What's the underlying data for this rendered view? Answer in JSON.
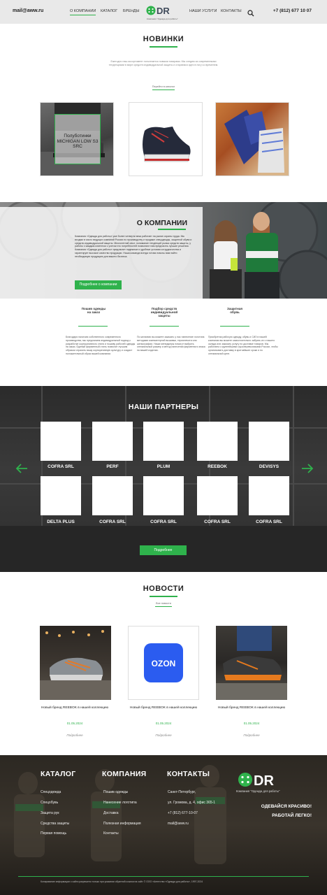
{
  "header": {
    "email": "mail@aww.ru",
    "nav": [
      "О КОМПАНИИ",
      "КАТАЛОГ",
      "БРЕНДЫ",
      "НАШИ УСЛУГИ",
      "КОНТАКТЫ"
    ],
    "logo_text": "ODR",
    "logo_caption": "Компания \"Одежда для работы\"",
    "phone": "+7 (812) 677 10 07",
    "icons": [
      "search-icon",
      "phone-icon"
    ],
    "accent_color": "#2fb24c"
  },
  "new_arrivals": {
    "title": "НОВИНКИ",
    "subtitle": "Ежегодно наш ассортимент пополняется новыми товарами. Мы следим за современными тенденциями в мире средств индивидуальной защиты и стараемся идти в ногу со временем.",
    "link": "Перейти в каталог",
    "products": [
      {
        "label": "Полуботинки MICHIGAN LOW S3 SRC"
      },
      {
        "label": ""
      },
      {
        "label": ""
      }
    ]
  },
  "about": {
    "title": "О КОМПАНИИ",
    "text": "Компания «Одежда для работы» уже более четверти века работает на рынке охраны труда. Мы входим в число ведущих компаний России по производству и продаже спецодежды, защитной обуви и средств индивидуальной защиты. Многолетний опыт, понимание тенденций рынка средств защиты, у работы с каждым клиентом с учетом его потребностей позволяют нам предлагать лучшие решения. Компания «Одежда для работы» предлагает надежные и удобные условия сотрудничества и гарантирует высокое качество продукции. Наша команда всегда готова помочь вам найти необходимую продукцию для вашего бизнеса.",
    "button": "Подробнее о компании"
  },
  "features": [
    {
      "name": "Пошив одежды на заказ",
      "text": "Благодаря наличию собственного современного производства, мы предлагаем индивидуальный подход к разработке корпоративного стиля и пошиву рабочей одежды на заказ. Единый фирменный стиль позволит лучшим образом отразить вашу корпоративную культуру и создаст положительный образ вашей компании."
    },
    {
      "name": "Подбор средств индивидуальной защиты",
      "text": "По желанию вы можете заказать у нас нанесение логотипа методами компьютерной вышивки, термопечати или шелкографии. Наши менеджеры помогут выбрать оптимальный размер и метод нанесения фирменного знака на вашей изделии."
    },
    {
      "name": "Защитная обувь",
      "text": "Приобретая рабочую одежду, обувь и СИЗ в нашей компании вы можете самостоятельно забрать их с нашего склада или заказать услугу по доставке товаров. Мы работаем с крупнейшими грузоперевозчиками России, чтобы организовать доставку в кратчайшие сроки и по оптимальной цене."
    }
  ],
  "partners": {
    "title": "НАШИ ПАРТНЕРЫ",
    "row1": [
      "COFRA SRL",
      "PERF",
      "PLUM",
      "REEBOK",
      "DEVISYS"
    ],
    "row2": [
      "DELTA PLUS",
      "COFRA SRL",
      "COFRA SRL",
      "COFRA SRL",
      "COFRA SRL"
    ],
    "button": "Подробнее",
    "icons": [
      "arrow-left-icon",
      "arrow-right-icon"
    ]
  },
  "news": {
    "title": "НОВОСТИ",
    "link": "Все новости",
    "items": [
      {
        "title": "Новый бренд REEBOK в нашей коллекцию",
        "date": "01.05.2024",
        "more": "Подробнее"
      },
      {
        "title": "Новый бренд REEBOK в нашей коллекцию",
        "date": "01.05.2024",
        "more": "Подробнее",
        "image_text": "OZON"
      },
      {
        "title": "Новый бренд REEBOK в нашей коллекцию",
        "date": "01.05.2024",
        "more": "Подробнее"
      }
    ]
  },
  "footer": {
    "catalog_title": "КАТАЛОГ",
    "catalog_links": [
      "Спецодежда",
      "Спецобувь",
      "Защита рук",
      "Средства защиты",
      "Первая помощь"
    ],
    "company_title": "КОМПАНИЯ",
    "company_links": [
      "Пошив одежды",
      "Нанесение логотипа",
      "Доставка",
      "Полезная информация",
      "Контакты"
    ],
    "contacts_title": "КОНТАКТЫ",
    "contacts": [
      "Санкт-Петербург,",
      "ул. Громова, д. 4, офис 365-1",
      "+7 (812) 677-10-07",
      "mail@aww.ru"
    ],
    "logo_text": "ODR",
    "logo_caption": "Компания \"Одежда для работы\"",
    "slogan1": "ОДЕВАЙСЯ КРАСИВО!",
    "slogan2": "РАБОТАЙ ЛЕГКО!",
    "copyright": "Копирование информации с сайта разрешено только при указании обратной ссылки на сайт. © ООО «Агентство «Одежда для работы», 1997-2024"
  }
}
